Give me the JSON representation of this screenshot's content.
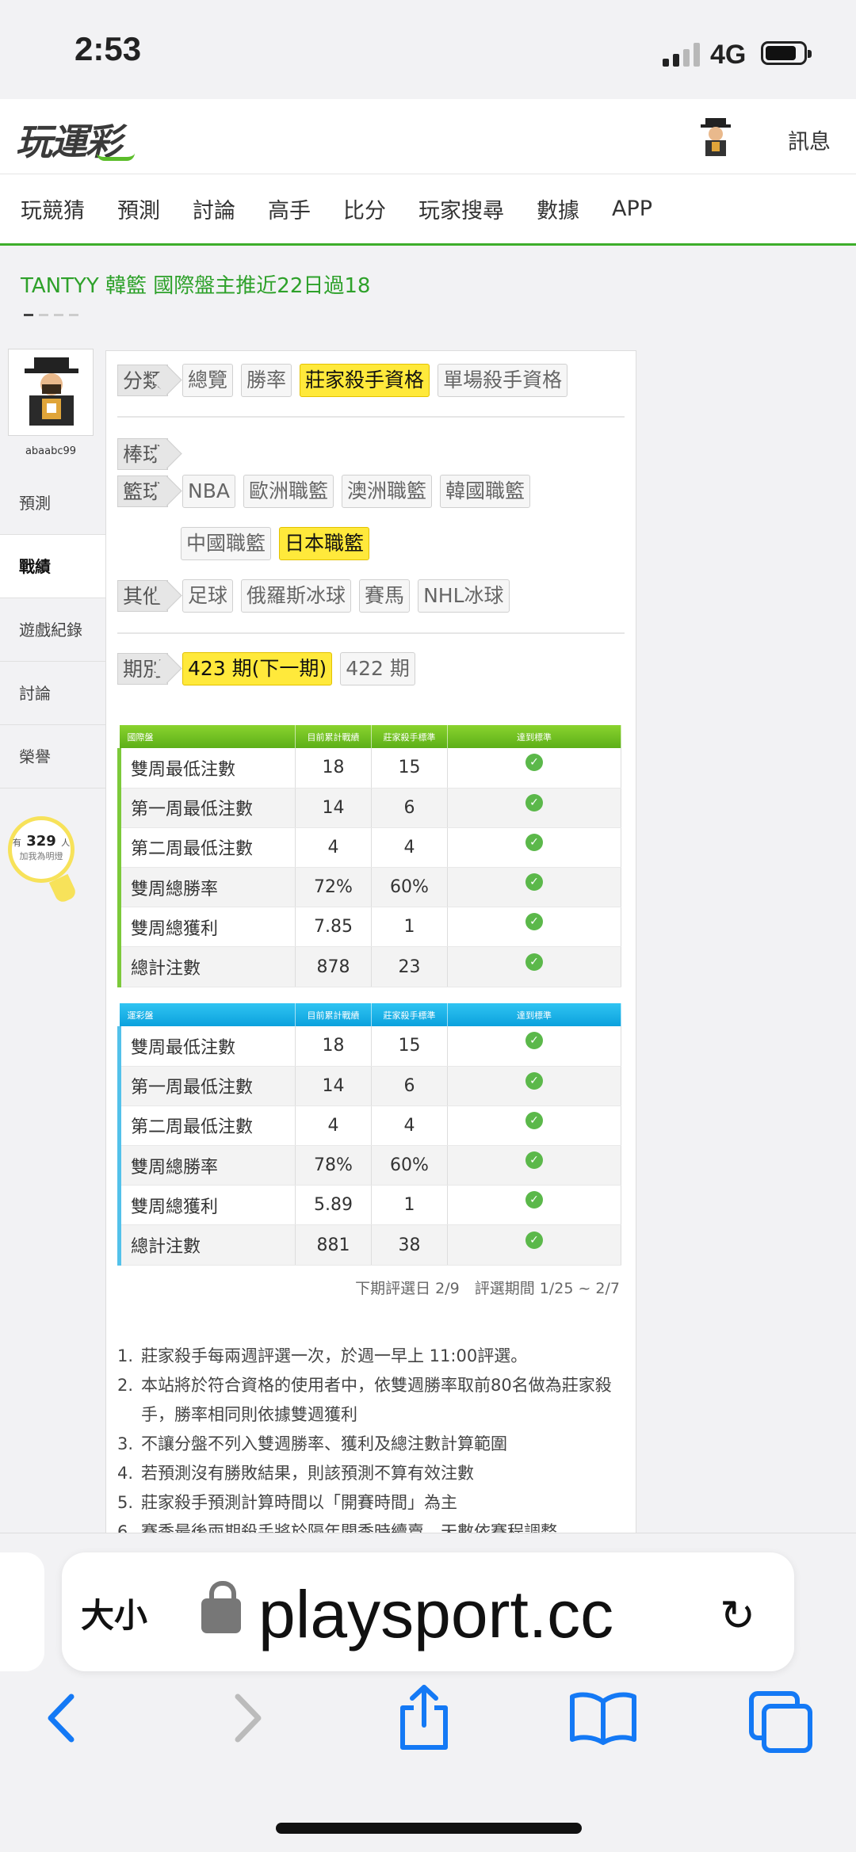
{
  "status": {
    "time": "2:53",
    "network": "4G"
  },
  "header": {
    "logo": "玩運彩",
    "message_label": "訊息"
  },
  "nav": [
    "玩競猜",
    "預測",
    "討論",
    "高手",
    "比分",
    "玩家搜尋",
    "數據",
    "APP"
  ],
  "ticker": "TANTYY 韓籃 國際盤主推近22日過18",
  "sidebar": {
    "username": "abaabc99",
    "items": [
      "預測",
      "戰績",
      "遊戲紀錄",
      "討論",
      "榮譽"
    ],
    "active": "戰績",
    "fans": {
      "prefix": "有",
      "count": "329",
      "suffix": "人",
      "label": "加我為明燈"
    }
  },
  "filters": {
    "category_label": "分類",
    "categories": [
      "總覽",
      "勝率",
      "莊家殺手資格",
      "單場殺手資格"
    ],
    "baseball_label": "棒球",
    "basketball_label": "籃球",
    "basketball": [
      "NBA",
      "歐洲職籃",
      "澳洲職籃",
      "韓國職籃"
    ],
    "basketball2": [
      "中國職籃",
      "日本職籃"
    ],
    "other_label": "其他",
    "others": [
      "足球",
      "俄羅斯冰球",
      "賽馬",
      "NHL冰球"
    ],
    "period_label": "期別",
    "periods": [
      "423 期(下一期)",
      "422 期"
    ]
  },
  "intl_table": {
    "headers": [
      "國際盤",
      "目前累計戰績",
      "莊家殺手標準",
      "達到標準"
    ],
    "rows": [
      [
        "雙周最低注數",
        "18",
        "15"
      ],
      [
        "第一周最低注數",
        "14",
        "6"
      ],
      [
        "第二周最低注數",
        "4",
        "4"
      ],
      [
        "雙周總勝率",
        "72%",
        "60%"
      ],
      [
        "雙周總獲利",
        "7.85",
        "1"
      ],
      [
        "總計注數",
        "878",
        "23"
      ]
    ]
  },
  "lottery_table": {
    "headers": [
      "運彩盤",
      "目前累計戰績",
      "莊家殺手標準",
      "達到標準"
    ],
    "rows": [
      [
        "雙周最低注數",
        "18",
        "15"
      ],
      [
        "第一周最低注數",
        "14",
        "6"
      ],
      [
        "第二周最低注數",
        "4",
        "4"
      ],
      [
        "雙周總勝率",
        "78%",
        "60%"
      ],
      [
        "雙周總獲利",
        "5.89",
        "1"
      ],
      [
        "總計注數",
        "881",
        "38"
      ]
    ]
  },
  "footnote": "下期評選日 2/9　評選期間 1/25 ~ 2/7",
  "notes": [
    "莊家殺手每兩週評選一次，於週一早上 11:00評選。",
    "本站將於符合資格的使用者中，依雙週勝率取前80名做為莊家殺手，勝率相同則依據雙週獲利",
    "不讓分盤不列入雙週勝率、獲利及總注數計算範圍",
    "若預測沒有勝敗結果，則該預測不算有效注數",
    "莊家殺手預測計算時間以「開賽時間」為主",
    "賽季最後兩期殺手將於隔年開季時續賣，天數依賽程調整。"
  ],
  "browser": {
    "size_label": "大小",
    "domain": "playsport.cc"
  }
}
